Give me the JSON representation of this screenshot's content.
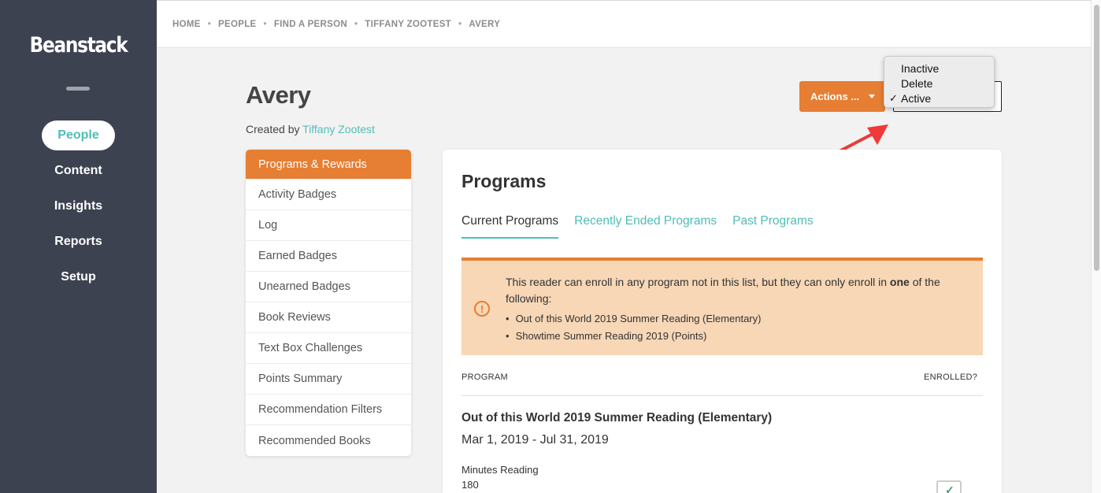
{
  "app": {
    "logo": "Beanstack"
  },
  "sidebar": {
    "items": [
      {
        "label": "People",
        "active": true
      },
      {
        "label": "Content"
      },
      {
        "label": "Insights"
      },
      {
        "label": "Reports"
      },
      {
        "label": "Setup"
      }
    ]
  },
  "breadcrumb": [
    "HOME",
    "PEOPLE",
    "FIND A PERSON",
    "TIFFANY ZOOTEST",
    "AVERY"
  ],
  "breadcrumb_separator": "•",
  "header": {
    "title": "Avery",
    "created_by_prefix": "Created by",
    "created_by_name": "Tiffany Zootest",
    "actions_label": "Actions ..."
  },
  "status_dropdown": {
    "options": [
      {
        "label": "Inactive",
        "checked": false
      },
      {
        "label": "Delete",
        "checked": false
      },
      {
        "label": "Active",
        "checked": true
      }
    ],
    "check_glyph": "✓"
  },
  "submenu": [
    {
      "label": "Programs & Rewards",
      "active": true
    },
    {
      "label": "Activity Badges"
    },
    {
      "label": "Log"
    },
    {
      "label": "Earned Badges"
    },
    {
      "label": "Unearned Badges"
    },
    {
      "label": "Book Reviews"
    },
    {
      "label": "Text Box Challenges"
    },
    {
      "label": "Points Summary"
    },
    {
      "label": "Recommendation Filters"
    },
    {
      "label": "Recommended Books"
    }
  ],
  "programs": {
    "title": "Programs",
    "tabs": [
      {
        "label": "Current Programs",
        "active": true
      },
      {
        "label": "Recently Ended Programs"
      },
      {
        "label": "Past Programs"
      }
    ],
    "notice": {
      "text_before": "This reader can enroll in any program not in this list, but they can only enroll in ",
      "text_bold": "one",
      "text_after": " of the following:",
      "items": [
        "Out of this World 2019 Summer Reading (Elementary)",
        "Showtime Summer Reading 2019 (Points)"
      ]
    },
    "columns": {
      "program": "PROGRAM",
      "enrolled": "ENROLLED?"
    },
    "rows": [
      {
        "name": "Out of this World 2019 Summer Reading (Elementary)",
        "dates": "Mar 1, 2019 - Jul 31, 2019",
        "metric_label": "Minutes Reading",
        "metric_value": "180",
        "enrolled": true
      }
    ]
  },
  "colors": {
    "accent_orange": "#e67e33",
    "teal": "#4fbdb7",
    "sidebar": "#3c4250",
    "notice_bg": "#f7d7b6",
    "annotation_arrow": "#ee3a3a"
  }
}
